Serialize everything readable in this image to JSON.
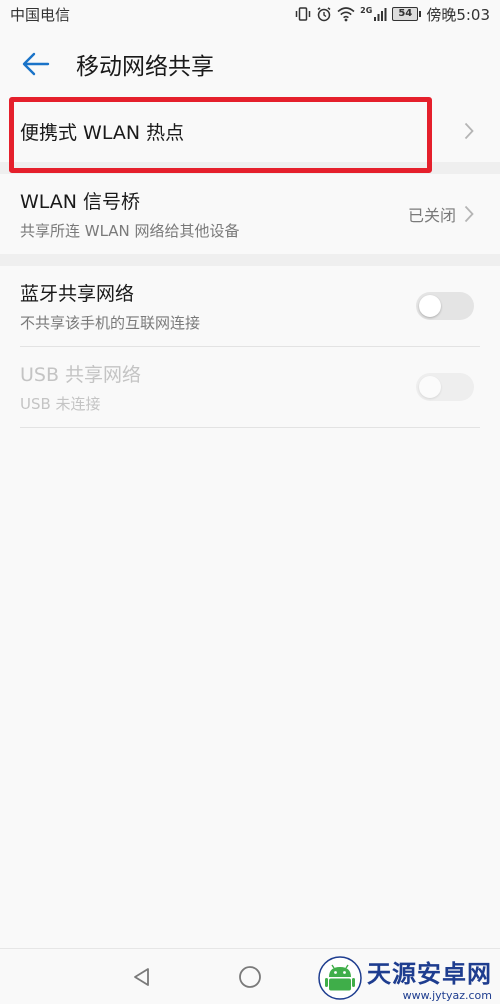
{
  "status_bar": {
    "carrier": "中国电信",
    "network": "2G",
    "battery": "54",
    "time": "傍晚5:03"
  },
  "app_bar": {
    "title": "移动网络共享",
    "back_icon": "arrow-left-icon"
  },
  "items": [
    {
      "title": "便携式 WLAN 热点",
      "subtitle": "",
      "value": ""
    },
    {
      "title": "WLAN 信号桥",
      "subtitle": "共享所连 WLAN 网络给其他设备",
      "value": "已关闭"
    },
    {
      "title": "蓝牙共享网络",
      "subtitle": "不共享该手机的互联网连接",
      "toggle": false
    },
    {
      "title": "USB 共享网络",
      "subtitle": "USB 未连接",
      "toggle": false,
      "disabled": true
    }
  ],
  "watermark": {
    "name": "天源安卓网",
    "url": "www.jytyaz.com"
  },
  "colors": {
    "accent": "#1a73c8",
    "highlight": "#e5202c"
  }
}
